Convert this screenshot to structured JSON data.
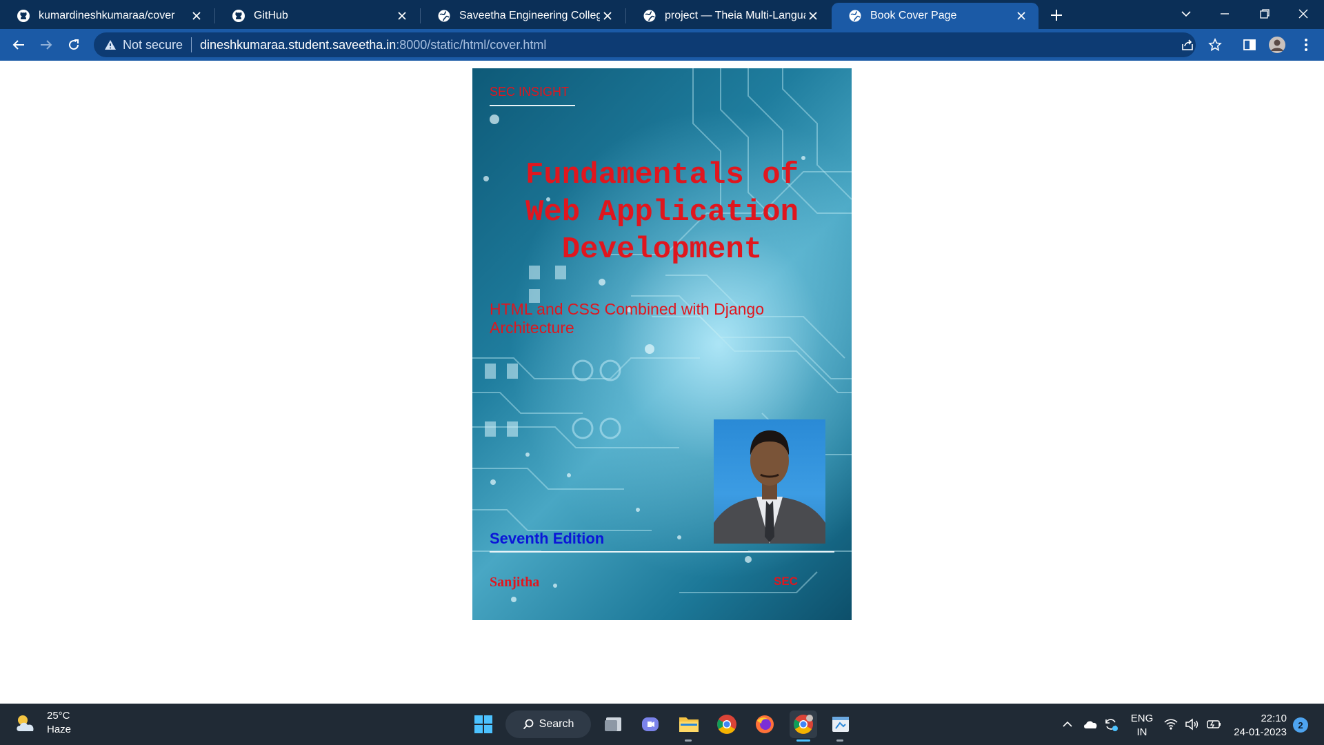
{
  "browser": {
    "tabs": [
      {
        "title": "kumardineshkumaraa/cover",
        "favicon": "github-icon",
        "active": false
      },
      {
        "title": "GitHub",
        "favicon": "github-icon",
        "active": false
      },
      {
        "title": "Saveetha Engineering College",
        "favicon": "globe-icon",
        "active": false
      },
      {
        "title": "project — Theia Multi-Language",
        "favicon": "globe-icon",
        "active": false
      },
      {
        "title": "Book Cover Page",
        "favicon": "globe-icon",
        "active": true
      }
    ],
    "security_label": "Not secure",
    "url_host": "dineshkumaraa.student.saveetha.in",
    "url_path": ":8000/static/html/cover.html",
    "colors": {
      "tabstrip": "#0b2f57",
      "toolbar": "#1b5aa6",
      "omnibox": "#0d3b73"
    }
  },
  "cover": {
    "tag": "SEC INSIGHT",
    "title_lines": [
      "Fundamentals of",
      "Web Application",
      "Development"
    ],
    "subtitle_line1": "HTML and CSS Combined with Django",
    "subtitle_line2": "Architecture",
    "edition": "Seventh Edition",
    "author": "Sanjitha",
    "publisher": "SEC",
    "colors": {
      "text_red": "#e0161e",
      "edition_blue": "#0a16d8"
    }
  },
  "taskbar": {
    "weather_temp": "25°C",
    "weather_desc": "Haze",
    "search_label": "Search",
    "lang_line1": "ENG",
    "lang_line2": "IN",
    "time": "22:10",
    "date": "24-01-2023",
    "notification_count": "2"
  }
}
